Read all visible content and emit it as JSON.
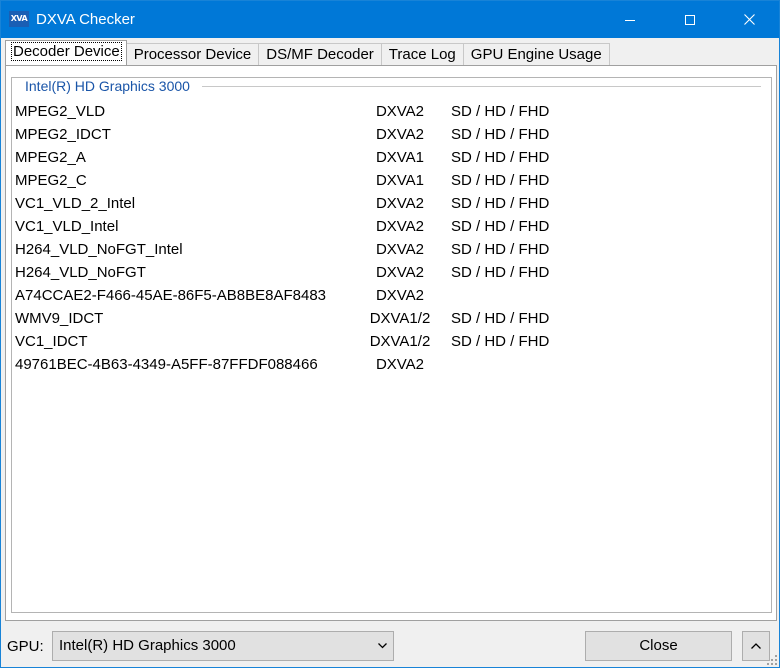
{
  "window": {
    "title": "DXVA Checker",
    "icon_text": "XVA"
  },
  "tabs": [
    {
      "label": "Decoder Device",
      "active": true
    },
    {
      "label": "Processor Device"
    },
    {
      "label": "DS/MF Decoder"
    },
    {
      "label": "Trace Log"
    },
    {
      "label": "GPU Engine Usage"
    }
  ],
  "group": {
    "title": "Intel(R) HD Graphics 3000"
  },
  "decoders": [
    {
      "name": "MPEG2_VLD",
      "api": "DXVA2",
      "res": "SD / HD / FHD"
    },
    {
      "name": "MPEG2_IDCT",
      "api": "DXVA2",
      "res": "SD / HD / FHD"
    },
    {
      "name": "MPEG2_A",
      "api": "DXVA1",
      "res": "SD / HD / FHD"
    },
    {
      "name": "MPEG2_C",
      "api": "DXVA1",
      "res": "SD / HD / FHD"
    },
    {
      "name": "VC1_VLD_2_Intel",
      "api": "DXVA2",
      "res": "SD / HD / FHD"
    },
    {
      "name": "VC1_VLD_Intel",
      "api": "DXVA2",
      "res": "SD / HD / FHD"
    },
    {
      "name": "H264_VLD_NoFGT_Intel",
      "api": "DXVA2",
      "res": "SD / HD / FHD"
    },
    {
      "name": "H264_VLD_NoFGT",
      "api": "DXVA2",
      "res": "SD / HD / FHD"
    },
    {
      "name": "A74CCAE2-F466-45AE-86F5-AB8BE8AF8483",
      "api": "DXVA2",
      "res": ""
    },
    {
      "name": "WMV9_IDCT",
      "api": "DXVA1/2",
      "res": "SD / HD / FHD"
    },
    {
      "name": "VC1_IDCT",
      "api": "DXVA1/2",
      "res": "SD / HD / FHD"
    },
    {
      "name": "49761BEC-4B63-4349-A5FF-87FFDF088466",
      "api": "DXVA2",
      "res": ""
    }
  ],
  "bottom": {
    "gpu_label": "GPU:",
    "gpu_selected": "Intel(R) HD Graphics 3000",
    "close_label": "Close"
  },
  "colors": {
    "titlebar": "#0078d7",
    "group_title": "#1a55a8"
  }
}
